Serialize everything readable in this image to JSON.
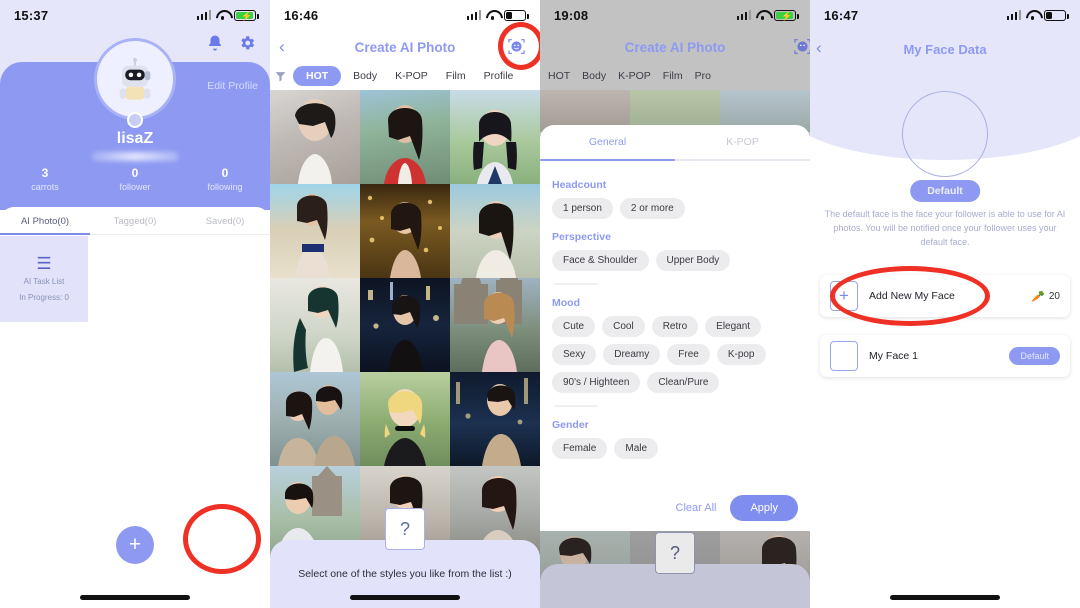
{
  "panels": {
    "profile": {
      "status": {
        "time": "15:37",
        "battery": "charging"
      },
      "icons": {
        "bell": "bell-icon",
        "gear": "gear-icon"
      },
      "edit_profile": "Edit Profile",
      "username": "lisaZ",
      "stats": [
        {
          "value": "3",
          "label": "carrots"
        },
        {
          "value": "0",
          "label": "follower"
        },
        {
          "value": "0",
          "label": "following"
        }
      ],
      "tabs": [
        {
          "label": "AI Photo(0)",
          "active": true
        },
        {
          "label": "Tagged(0)",
          "active": false
        },
        {
          "label": "Saved(0)",
          "active": false
        }
      ],
      "task_card": {
        "title": "AI Task List",
        "subtitle": "In Progress: 0"
      },
      "fab": "+"
    },
    "create": {
      "status": {
        "time": "16:46",
        "battery": "low"
      },
      "back": "‹",
      "title": "Create AI Photo",
      "face_icon": "face-scan-icon",
      "filter_icon": "funnel-icon",
      "categories": [
        "HOT",
        "Body",
        "K-POP",
        "Film",
        "Profile"
      ],
      "active_category": "HOT",
      "hint": "Select one of the styles you like from the list :)",
      "question_mark": "?"
    },
    "filter": {
      "status": {
        "time": "19:08",
        "battery": "charging"
      },
      "title": "Create AI Photo",
      "face_icon": "face-scan-icon",
      "categories": [
        "HOT",
        "Body",
        "K-POP",
        "Film",
        "Pro"
      ],
      "tabs": [
        {
          "label": "General",
          "active": true
        },
        {
          "label": "K-POP",
          "active": false
        }
      ],
      "groups": [
        {
          "title": "Headcount",
          "options": [
            "1 person",
            "2 or more"
          ]
        },
        {
          "title": "Perspective",
          "options": [
            "Face & Shoulder",
            "Upper Body"
          ]
        },
        {
          "title": "Mood",
          "options": [
            "Cute",
            "Cool",
            "Retro",
            "Elegant",
            "Sexy",
            "Dreamy",
            "Free",
            "K-pop",
            "90's / Highteen",
            "Clean/Pure"
          ]
        },
        {
          "title": "Gender",
          "options": [
            "Female",
            "Male"
          ]
        }
      ],
      "clear_all": "Clear All",
      "apply": "Apply",
      "question_mark": "?"
    },
    "face_data": {
      "status": {
        "time": "16:47",
        "battery": "low"
      },
      "back": "‹",
      "title": "My Face Data",
      "default_badge": "Default",
      "description": "The default face is the face your follower is able to use for AI photos. You will be notified once your follower uses your default face.",
      "rows": [
        {
          "name": "add-new-face",
          "plus": "+",
          "label": "Add New My Face",
          "cost": "20",
          "carrot": "🥕"
        },
        {
          "name": "my-face-1",
          "plus": "",
          "label": "My Face 1",
          "badge": "Default"
        }
      ]
    }
  },
  "colors": {
    "accent": "#8e9af2",
    "lavender_bg": "#e6e6fb",
    "annotation": "#ee3124",
    "chip_bg": "#ececee"
  }
}
